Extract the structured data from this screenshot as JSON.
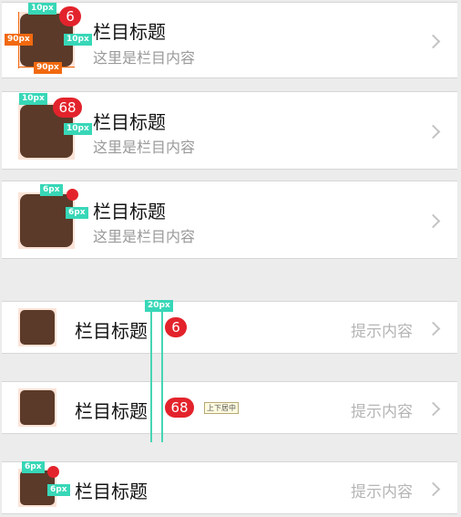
{
  "rows": [
    {
      "title": "栏目标题",
      "subtitle": "这里是栏目内容",
      "badge": "6"
    },
    {
      "title": "栏目标题",
      "subtitle": "这里是栏目内容",
      "badge": "68"
    },
    {
      "title": "栏目标题",
      "subtitle": "这里是栏目内容"
    },
    {
      "title": "栏目标题",
      "badge": "6",
      "hint": "提示内容"
    },
    {
      "title": "栏目标题",
      "badge": "68",
      "hint": "提示内容",
      "tag": "上下居中"
    },
    {
      "title": "栏目标题",
      "hint": "提示内容"
    }
  ],
  "annotations": {
    "a10": "10px",
    "a90": "90px",
    "a6": "6px",
    "a20": "20px"
  },
  "colors": {
    "badge": "#e3232c",
    "thumb": "#5b3a29",
    "annotation": "#37d7b7",
    "annotation_orange": "#f1690f"
  }
}
